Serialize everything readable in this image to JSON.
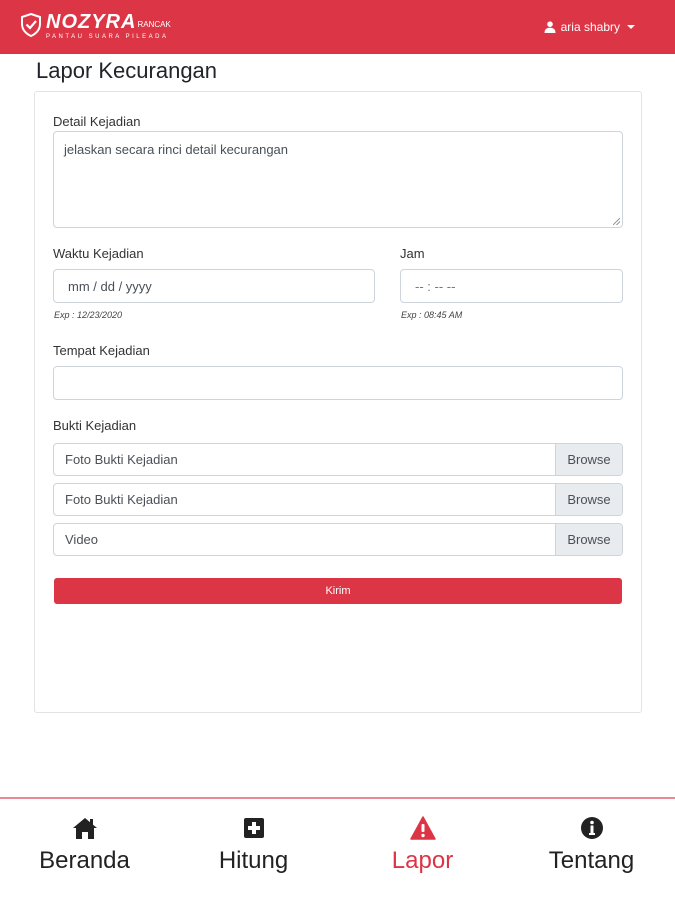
{
  "header": {
    "brand_name": "NOZYRA",
    "brand_sub": "RANCAK",
    "brand_tagline": "PANTAU SUARA PILEADA",
    "user_name": "aria shabry",
    "background_color": "#dc3545"
  },
  "page": {
    "title": "Lapor Kecurangan"
  },
  "form": {
    "detail_label": "Detail Kejadian",
    "detail_placeholder": "jelaskan secara rinci detail kecurangan",
    "date_label": "Waktu Kejadian",
    "date_placeholder": "mm / dd / yyyy",
    "date_hint": "Exp : 12/23/2020",
    "time_label": "Jam",
    "time_placeholder": "-- : --  --",
    "time_hint": "Exp : 08:45 AM",
    "place_label": "Tempat Kejadian",
    "place_value": "",
    "evidence_label": "Bukti Kejadian",
    "files": [
      {
        "name": "Foto Bukti Kejadian",
        "button": "Browse"
      },
      {
        "name": "Foto Bukti Kejadian",
        "button": "Browse"
      },
      {
        "name": "Video",
        "button": "Browse"
      }
    ],
    "submit_label": "Kirim"
  },
  "bottom_nav": {
    "items": [
      {
        "label": "Beranda",
        "icon": "home-icon"
      },
      {
        "label": "Hitung",
        "icon": "plus-square-icon"
      },
      {
        "label": "Lapor",
        "icon": "warning-icon",
        "active": true
      },
      {
        "label": "Tentang",
        "icon": "info-icon"
      }
    ],
    "active_color": "#dc3545"
  }
}
